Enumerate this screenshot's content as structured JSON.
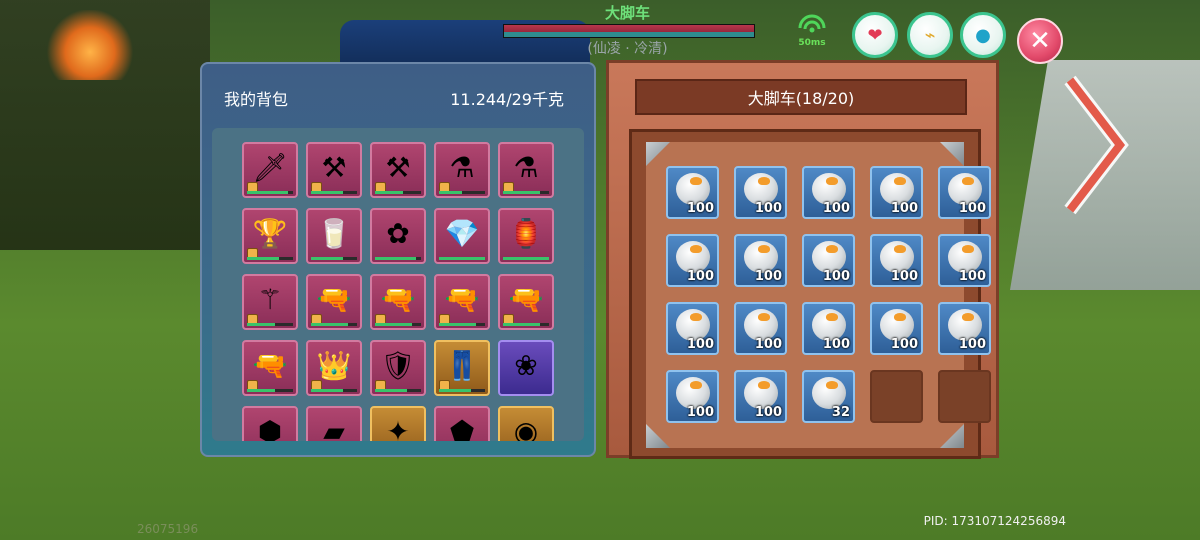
{
  "header": {
    "vehicle_name": "大脚车",
    "vehicle_owner": "(仙凌 · 冷清)",
    "ping": "50ms"
  },
  "status_icons": [
    {
      "name": "heart-icon",
      "glyph": "❤",
      "color": "#e23a55"
    },
    {
      "name": "stomach-icon",
      "glyph": "⌁",
      "color": "#e0a82a"
    },
    {
      "name": "water-drop-icon",
      "glyph": "●",
      "color": "#1fa3c9"
    }
  ],
  "close_glyph": "✕",
  "backpack": {
    "title": "我的背包",
    "weight": "11.244/29千克",
    "items": [
      {
        "name": "dagger",
        "glyph": "🗡",
        "tier": "normal",
        "locked": true,
        "durability": 0.9
      },
      {
        "name": "scythe",
        "glyph": "⚒",
        "tier": "normal",
        "locked": true,
        "durability": 0.7
      },
      {
        "name": "scythe-dark",
        "glyph": "⚒",
        "tier": "normal",
        "locked": true,
        "durability": 0.6
      },
      {
        "name": "watering-can",
        "glyph": "⚗",
        "tier": "normal",
        "locked": true,
        "durability": 0.5
      },
      {
        "name": "watering-can-silver",
        "glyph": "⚗",
        "tier": "normal",
        "locked": true,
        "durability": 0.8
      },
      {
        "name": "gold-trophy",
        "glyph": "🏆",
        "tier": "normal",
        "locked": true,
        "durability": 0.7
      },
      {
        "name": "milk-carton",
        "glyph": "🥛",
        "tier": "normal",
        "locked": false,
        "durability": 0.7
      },
      {
        "name": "flower-whip",
        "glyph": "✿",
        "tier": "normal",
        "locked": false,
        "durability": 0.9
      },
      {
        "name": "crystal-cone",
        "glyph": "💎",
        "tier": "normal",
        "locked": false,
        "durability": 1.0
      },
      {
        "name": "lantern",
        "glyph": "🏮",
        "tier": "normal",
        "locked": false,
        "durability": 1.0
      },
      {
        "name": "gold-staff",
        "glyph": "⚚",
        "tier": "normal",
        "locked": true,
        "durability": 0.6
      },
      {
        "name": "rifle",
        "glyph": "🔫",
        "tier": "normal",
        "locked": true,
        "durability": 0.8
      },
      {
        "name": "rifle-two",
        "glyph": "🔫",
        "tier": "normal",
        "locked": true,
        "durability": 0.8
      },
      {
        "name": "rifle-frost",
        "glyph": "🔫",
        "tier": "normal",
        "locked": true,
        "durability": 0.8
      },
      {
        "name": "rifle-four",
        "glyph": "🔫",
        "tier": "normal",
        "locked": true,
        "durability": 0.8
      },
      {
        "name": "rifle-fire",
        "glyph": "🔫",
        "tier": "normal",
        "locked": true,
        "durability": 0.6
      },
      {
        "name": "crystal-helmet",
        "glyph": "👑",
        "tier": "normal",
        "locked": true,
        "durability": 0.7
      },
      {
        "name": "crystal-armor",
        "glyph": "🛡",
        "tier": "normal",
        "locked": true,
        "durability": 0.7
      },
      {
        "name": "crystal-leggings",
        "glyph": "👖",
        "tier": "rare",
        "locked": true,
        "durability": 0.7
      },
      {
        "name": "purple-flower-bundle",
        "glyph": "❀",
        "tier": "epic",
        "locked": false,
        "durability": 0.0
      },
      {
        "name": "stone",
        "glyph": "⬢",
        "tier": "normal",
        "locked": false,
        "durability": 0.0
      },
      {
        "name": "yellow-block",
        "glyph": "▰",
        "tier": "normal",
        "locked": false,
        "durability": 0.0
      },
      {
        "name": "purple-item",
        "glyph": "✦",
        "tier": "rare",
        "locked": false,
        "durability": 0.0
      },
      {
        "name": "gold-nugget",
        "glyph": "⬟",
        "tier": "normal",
        "locked": false,
        "durability": 0.0
      },
      {
        "name": "gold-coin",
        "glyph": "◉",
        "tier": "rare",
        "locked": false,
        "durability": 0.0
      }
    ]
  },
  "storage": {
    "title": "大脚车(18/20)",
    "slots": [
      {
        "item": "stone-ore",
        "qty": "100"
      },
      {
        "item": "stone-ore",
        "qty": "100"
      },
      {
        "item": "stone-ore",
        "qty": "100"
      },
      {
        "item": "stone-ore",
        "qty": "100"
      },
      {
        "item": "stone-ore",
        "qty": "100"
      },
      {
        "item": "stone-ore",
        "qty": "100"
      },
      {
        "item": "stone-ore",
        "qty": "100"
      },
      {
        "item": "stone-ore",
        "qty": "100"
      },
      {
        "item": "stone-ore",
        "qty": "100"
      },
      {
        "item": "stone-ore",
        "qty": "100"
      },
      {
        "item": "stone-ore",
        "qty": "100"
      },
      {
        "item": "stone-ore",
        "qty": "100"
      },
      {
        "item": "stone-ore",
        "qty": "100"
      },
      {
        "item": "stone-ore",
        "qty": "100"
      },
      {
        "item": "stone-ore",
        "qty": "100"
      },
      {
        "item": "stone-ore",
        "qty": "100"
      },
      {
        "item": "stone-ore",
        "qty": "100"
      },
      {
        "item": "stone-ore",
        "qty": "32"
      },
      {
        "item": "",
        "qty": ""
      },
      {
        "item": "",
        "qty": ""
      }
    ]
  },
  "footer": {
    "left_id": "26075196",
    "pid": "PID: 173107124256894"
  }
}
